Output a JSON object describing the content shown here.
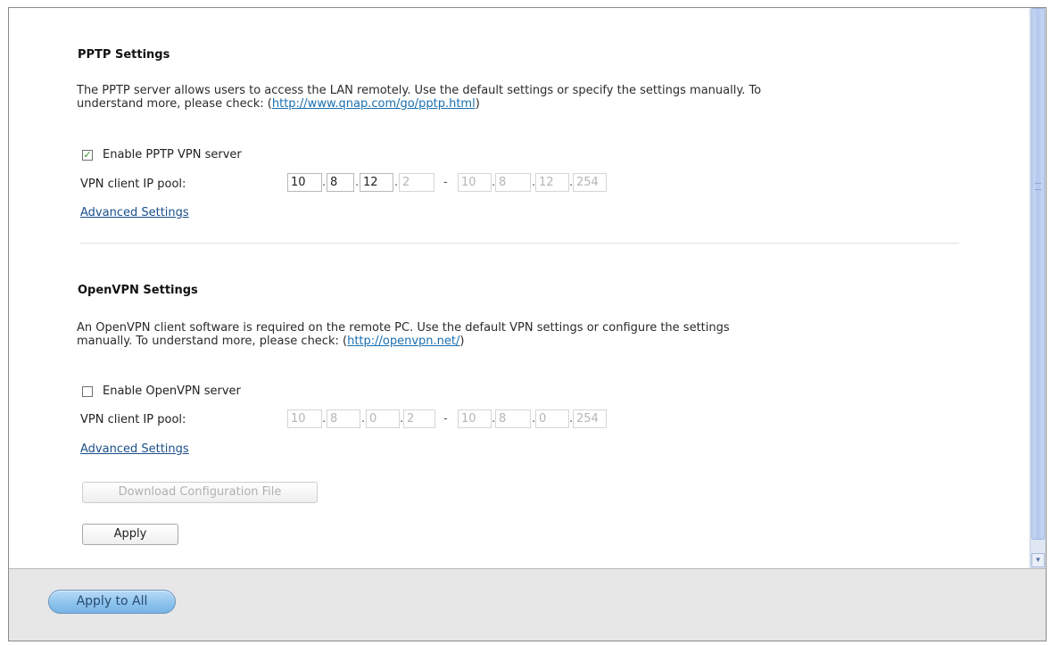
{
  "pptp": {
    "title": "PPTP Settings",
    "desc_line1": "The PPTP server allows users to access the LAN remotely. Use the default settings or specify the settings manually. To",
    "desc_line2_prefix": "understand more, please check: (",
    "desc_link": "http://www.qnap.com/go/pptp.html",
    "desc_line2_suffix": ")",
    "enable_label": "Enable PPTP VPN server",
    "enable_checked": true,
    "pool_label": "VPN client IP pool:",
    "pool_start": [
      "10",
      "8",
      "12",
      "2"
    ],
    "pool_end": [
      "10",
      "8",
      "12",
      "254"
    ],
    "advanced": "Advanced Settings"
  },
  "openvpn": {
    "title": "OpenVPN Settings",
    "desc_line1": "An OpenVPN client software is required on the remote PC. Use the default VPN settings or configure the settings",
    "desc_line2_prefix": "manually. To understand more, please check: (",
    "desc_link": "http://openvpn.net/",
    "desc_line2_suffix": ")",
    "enable_label": "Enable OpenVPN server",
    "enable_checked": false,
    "pool_label": "VPN client IP pool:",
    "pool_start": [
      "10",
      "8",
      "0",
      "2"
    ],
    "pool_end": [
      "10",
      "8",
      "0",
      "254"
    ],
    "advanced": "Advanced Settings",
    "download_label": "Download Configuration File"
  },
  "apply_label": "Apply",
  "apply_all_label": "Apply to All",
  "ip_separator": ".",
  "range_separator": "-",
  "check_mark": "✓",
  "scroll_down_glyph": "▾",
  "colors": {
    "link": "#1a6fb0",
    "apply_all_bg": "#8ec4ee",
    "footer_bg": "#e7e7e7"
  }
}
